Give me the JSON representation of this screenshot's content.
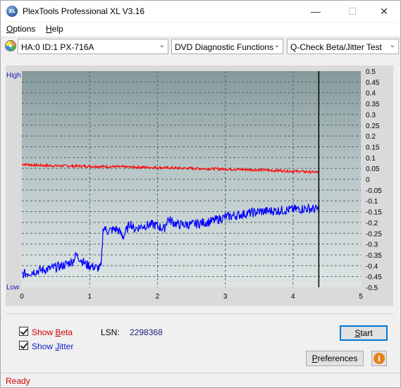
{
  "window": {
    "title": "PlexTools Professional XL V3.16",
    "icon_text": "XL",
    "minimize_glyph": "—",
    "maximize_glyph": "☐",
    "close_glyph": "✕"
  },
  "menu": {
    "options_accel": "O",
    "options_rest": "ptions",
    "help_accel": "H",
    "help_rest": "elp"
  },
  "toolbar": {
    "drive": "HA:0 ID:1  PX-716A",
    "function": "DVD Diagnostic Functions",
    "test": "Q-Check Beta/Jitter Test",
    "dropdown_glyph": "⌄"
  },
  "chart_data": {
    "type": "line",
    "title": "",
    "y_left_top": "High",
    "y_left_bottom": "Low",
    "x_ticks": [
      "0",
      "1",
      "2",
      "3",
      "4",
      "5"
    ],
    "xlim": [
      0,
      5
    ],
    "y2_ticks": [
      "0.5",
      "0.45",
      "0.4",
      "0.35",
      "0.3",
      "0.25",
      "0.2",
      "0.15",
      "0.1",
      "0.05",
      "0",
      "-0.05",
      "-0.1",
      "-0.15",
      "-0.2",
      "-0.25",
      "-0.3",
      "-0.35",
      "-0.4",
      "-0.45",
      "-0.5"
    ],
    "y2lim": [
      -0.5,
      0.5
    ],
    "grid": true,
    "end_marker_x": 4.38,
    "colors": {
      "beta": "#ff0000",
      "jitter": "#0000ff",
      "marker": "#000000"
    },
    "series": [
      {
        "name": "Beta",
        "x": [
          0,
          0.2,
          0.5,
          1.0,
          1.5,
          2.0,
          2.5,
          3.0,
          3.5,
          4.0,
          4.38
        ],
        "y": [
          0.07,
          0.065,
          0.062,
          0.06,
          0.057,
          0.054,
          0.05,
          0.047,
          0.043,
          0.037,
          0.032
        ]
      },
      {
        "name": "Jitter",
        "x": [
          0,
          0.2,
          0.4,
          0.6,
          0.75,
          0.8,
          0.95,
          1.1,
          1.17,
          1.2,
          1.25,
          1.4,
          1.5,
          1.6,
          1.65,
          1.8,
          1.95,
          2.1,
          2.15,
          2.3,
          2.5,
          2.8,
          3.0,
          3.3,
          3.5,
          3.8,
          4.0,
          4.2,
          4.38
        ],
        "y": [
          -0.44,
          -0.425,
          -0.415,
          -0.4,
          -0.38,
          -0.35,
          -0.395,
          -0.41,
          -0.41,
          -0.215,
          -0.24,
          -0.23,
          -0.265,
          -0.2,
          -0.23,
          -0.215,
          -0.21,
          -0.23,
          -0.185,
          -0.21,
          -0.21,
          -0.195,
          -0.175,
          -0.16,
          -0.15,
          -0.145,
          -0.14,
          -0.135,
          -0.14
        ]
      }
    ]
  },
  "controls": {
    "show_beta_accel": "B",
    "show_beta_pre": "Show ",
    "show_beta_post": "eta",
    "show_jitter_accel": "J",
    "show_jitter_pre": "Show ",
    "show_jitter_post": "itter",
    "lsn_label": "LSN:",
    "lsn_value": "2298368",
    "start_accel": "S",
    "start_rest": "tart",
    "preferences_accel": "P",
    "preferences_rest": "references",
    "info_glyph": "i"
  },
  "status": {
    "text": "Ready"
  }
}
